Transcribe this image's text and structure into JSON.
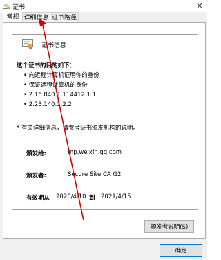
{
  "window": {
    "title": "证书",
    "close_symbol": "×"
  },
  "tabs": [
    {
      "label": "常规",
      "active": true
    },
    {
      "label": "详细信息",
      "active": false
    },
    {
      "label": "证书路径",
      "active": false
    }
  ],
  "cert": {
    "header": "证书信息",
    "purpose_title": "这个证书的目的如下：",
    "purposes": [
      "• 向远程计算机证明你的身份",
      "• 保证远程计算机的身份",
      "• 2.16.840.1.114412.1.1",
      "• 2.23.140.1.2.2"
    ],
    "note": "* 有关详细信息，请参考证书颁发机构的说明。",
    "issued_to_label": "颁发给:",
    "issued_to": "mp.weixin.qq.com",
    "issued_by_label": "颁发者:",
    "issued_by": "Secure Site CA G2",
    "valid_label": "有效期从",
    "valid_from": "2020/4/10",
    "valid_to_word": "到",
    "valid_to": "2021/4/15"
  },
  "buttons": {
    "issuer_statement": "颁发者说明(S)",
    "ok": "确定"
  },
  "colors": {
    "annotation_arrow": "#d40000",
    "ok_border": "#0078d7"
  }
}
